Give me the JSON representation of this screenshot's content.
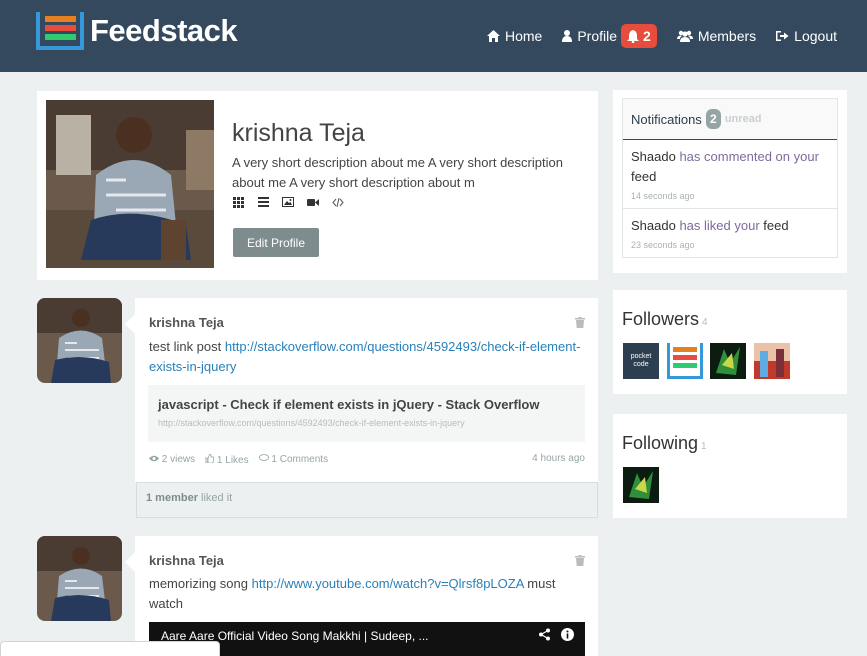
{
  "navbar": {
    "brand": "Feedstack",
    "items": [
      {
        "label": "Home",
        "icon": "home-icon"
      },
      {
        "label": "Profile",
        "icon": "user-icon"
      },
      {
        "label": "Members",
        "icon": "users-icon"
      },
      {
        "label": "Logout",
        "icon": "logout-icon"
      }
    ],
    "notification_count": "2",
    "colors": {
      "bg": "#34495e",
      "badge": "#e74c3c",
      "logo_blue": "#3498db",
      "logo_orange": "#e67e22",
      "logo_red": "#e74c3c",
      "logo_green": "#2ecc71"
    }
  },
  "profile": {
    "name": "krishna Teja",
    "description": "A very short description about me A very short description about me A very short description about m",
    "tools": [
      "grid-icon",
      "list-icon",
      "image-icon",
      "video-icon",
      "code-icon"
    ],
    "edit_button": "Edit Profile"
  },
  "posts": [
    {
      "author": "krishna Teja",
      "text": "test link post",
      "link": "http://stackoverflow.com/questions/4592493/check-if-element-exists-in-jquery",
      "preview_title": "javascript - Check if element exists in jQuery - Stack Overflow",
      "preview_url": "http://stackoverflow.com/questions/4592493/check-if-element-exists-in-jquery",
      "views": "2 views",
      "likes": "1 Likes",
      "comments": "1 Comments",
      "time": "4 hours ago",
      "liked_by": "1 member",
      "liked_suffix": "liked it"
    },
    {
      "author": "krishna Teja",
      "text": "memorizing song",
      "link": "http://www.youtube.com/watch?v=Qlrsf8pLOZA",
      "text_suffix": "must watch",
      "video_title": "Aare Aare Official Video Song Makkhi | Sudeep, ..."
    }
  ],
  "notifications": {
    "title": "Notifications",
    "count": "2",
    "unread_label": "unread",
    "items": [
      {
        "user": "Shaado",
        "action": "has commented on your",
        "object": "feed",
        "time": "14 seconds ago"
      },
      {
        "user": "Shaado",
        "action": "has liked your",
        "object": "feed",
        "time": "23 seconds ago"
      }
    ]
  },
  "followers": {
    "title": "Followers",
    "count": "4",
    "thumb_text": "pocket code"
  },
  "following": {
    "title": "Following",
    "count": "1"
  }
}
